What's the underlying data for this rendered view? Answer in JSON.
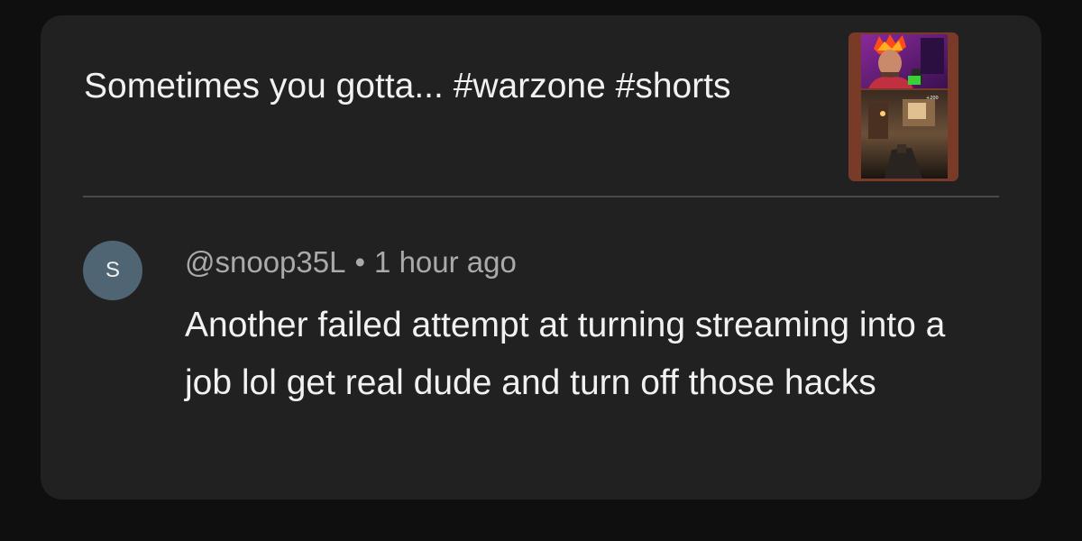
{
  "video": {
    "title": "Sometimes you gotta... #warzone #shorts",
    "thumbnail_icon": "video-thumbnail"
  },
  "comment": {
    "avatar_initial": "S",
    "avatar_color": "#4f6573",
    "author": "@snoop35L",
    "separator": "•",
    "time": "1 hour ago",
    "text": "Another failed attempt at turning streaming into a job lol get real dude and turn off those hacks"
  }
}
